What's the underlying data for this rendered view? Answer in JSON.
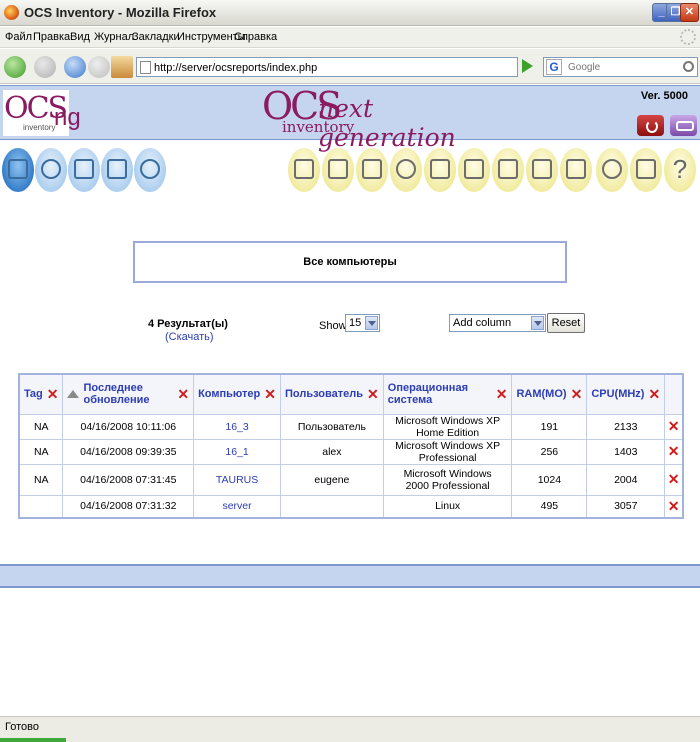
{
  "window": {
    "title": "OCS Inventory - Mozilla Firefox"
  },
  "menu": [
    "Файл",
    "Правка",
    "Вид",
    "Журнал",
    "Закладки",
    "Инструменты",
    "Справка"
  ],
  "nav": {
    "url": "http://server/ocsreports/index.php",
    "search_placeholder": "Google",
    "search_engine_letter": "G"
  },
  "header": {
    "logo_left": {
      "ocs": "OCS",
      "inventory": "inventory",
      "ng": "ng"
    },
    "logo_center": {
      "ocs": "OCS",
      "next": "next generation",
      "inventory": "inventory"
    },
    "version": "Ver. 5000"
  },
  "left_icons": [
    "computers-icon",
    "filter-icon",
    "network-icon",
    "duplicates-icon",
    "search-icon"
  ],
  "right_icons": [
    "gift-icon",
    "factory-icon",
    "deploy-icon",
    "config-icon",
    "tools-icon",
    "registry-icon",
    "dictionary-icon",
    "wallet-icon",
    "device-icon",
    "help-user-icon",
    "label-icon",
    "help-icon"
  ],
  "page": {
    "heading": "Все компьютеры",
    "results": "4 Результат(ы)",
    "download": "(Скачать)",
    "show_label": "Show:",
    "show_value": "15",
    "add_column": "Add column",
    "reset": "Reset"
  },
  "table": {
    "columns": [
      "Tag",
      "Последнее обновление",
      "Компьютер",
      "Пользователь",
      "Операционная система",
      "RAM(MO)",
      "CPU(MHz)"
    ],
    "rows": [
      {
        "tag": "NA",
        "last_update": "04/16/2008 10:11:06",
        "computer": "16_3",
        "user": "Пользователь",
        "os": "Microsoft Windows XP Home Edition",
        "ram": "191",
        "cpu": "2133"
      },
      {
        "tag": "NA",
        "last_update": "04/16/2008 09:39:35",
        "computer": "16_1",
        "user": "alex",
        "os": "Microsoft Windows XP Professional",
        "ram": "256",
        "cpu": "1403"
      },
      {
        "tag": "NA",
        "last_update": "04/16/2008 07:31:45",
        "computer": "TAURUS",
        "user": "eugene",
        "os": "Microsoft Windows 2000 Professional",
        "ram": "1024",
        "cpu": "2004"
      },
      {
        "tag": "",
        "last_update": "04/16/2008 07:31:32",
        "computer": "server",
        "user": "",
        "os": "Linux",
        "ram": "495",
        "cpu": "3057"
      }
    ]
  },
  "status": {
    "text": "Готово"
  },
  "colors": {
    "header_bg": "#c5d4ef",
    "link": "#2d3db3",
    "delete_x": "#d11c1c",
    "brand": "#8a1b62"
  }
}
